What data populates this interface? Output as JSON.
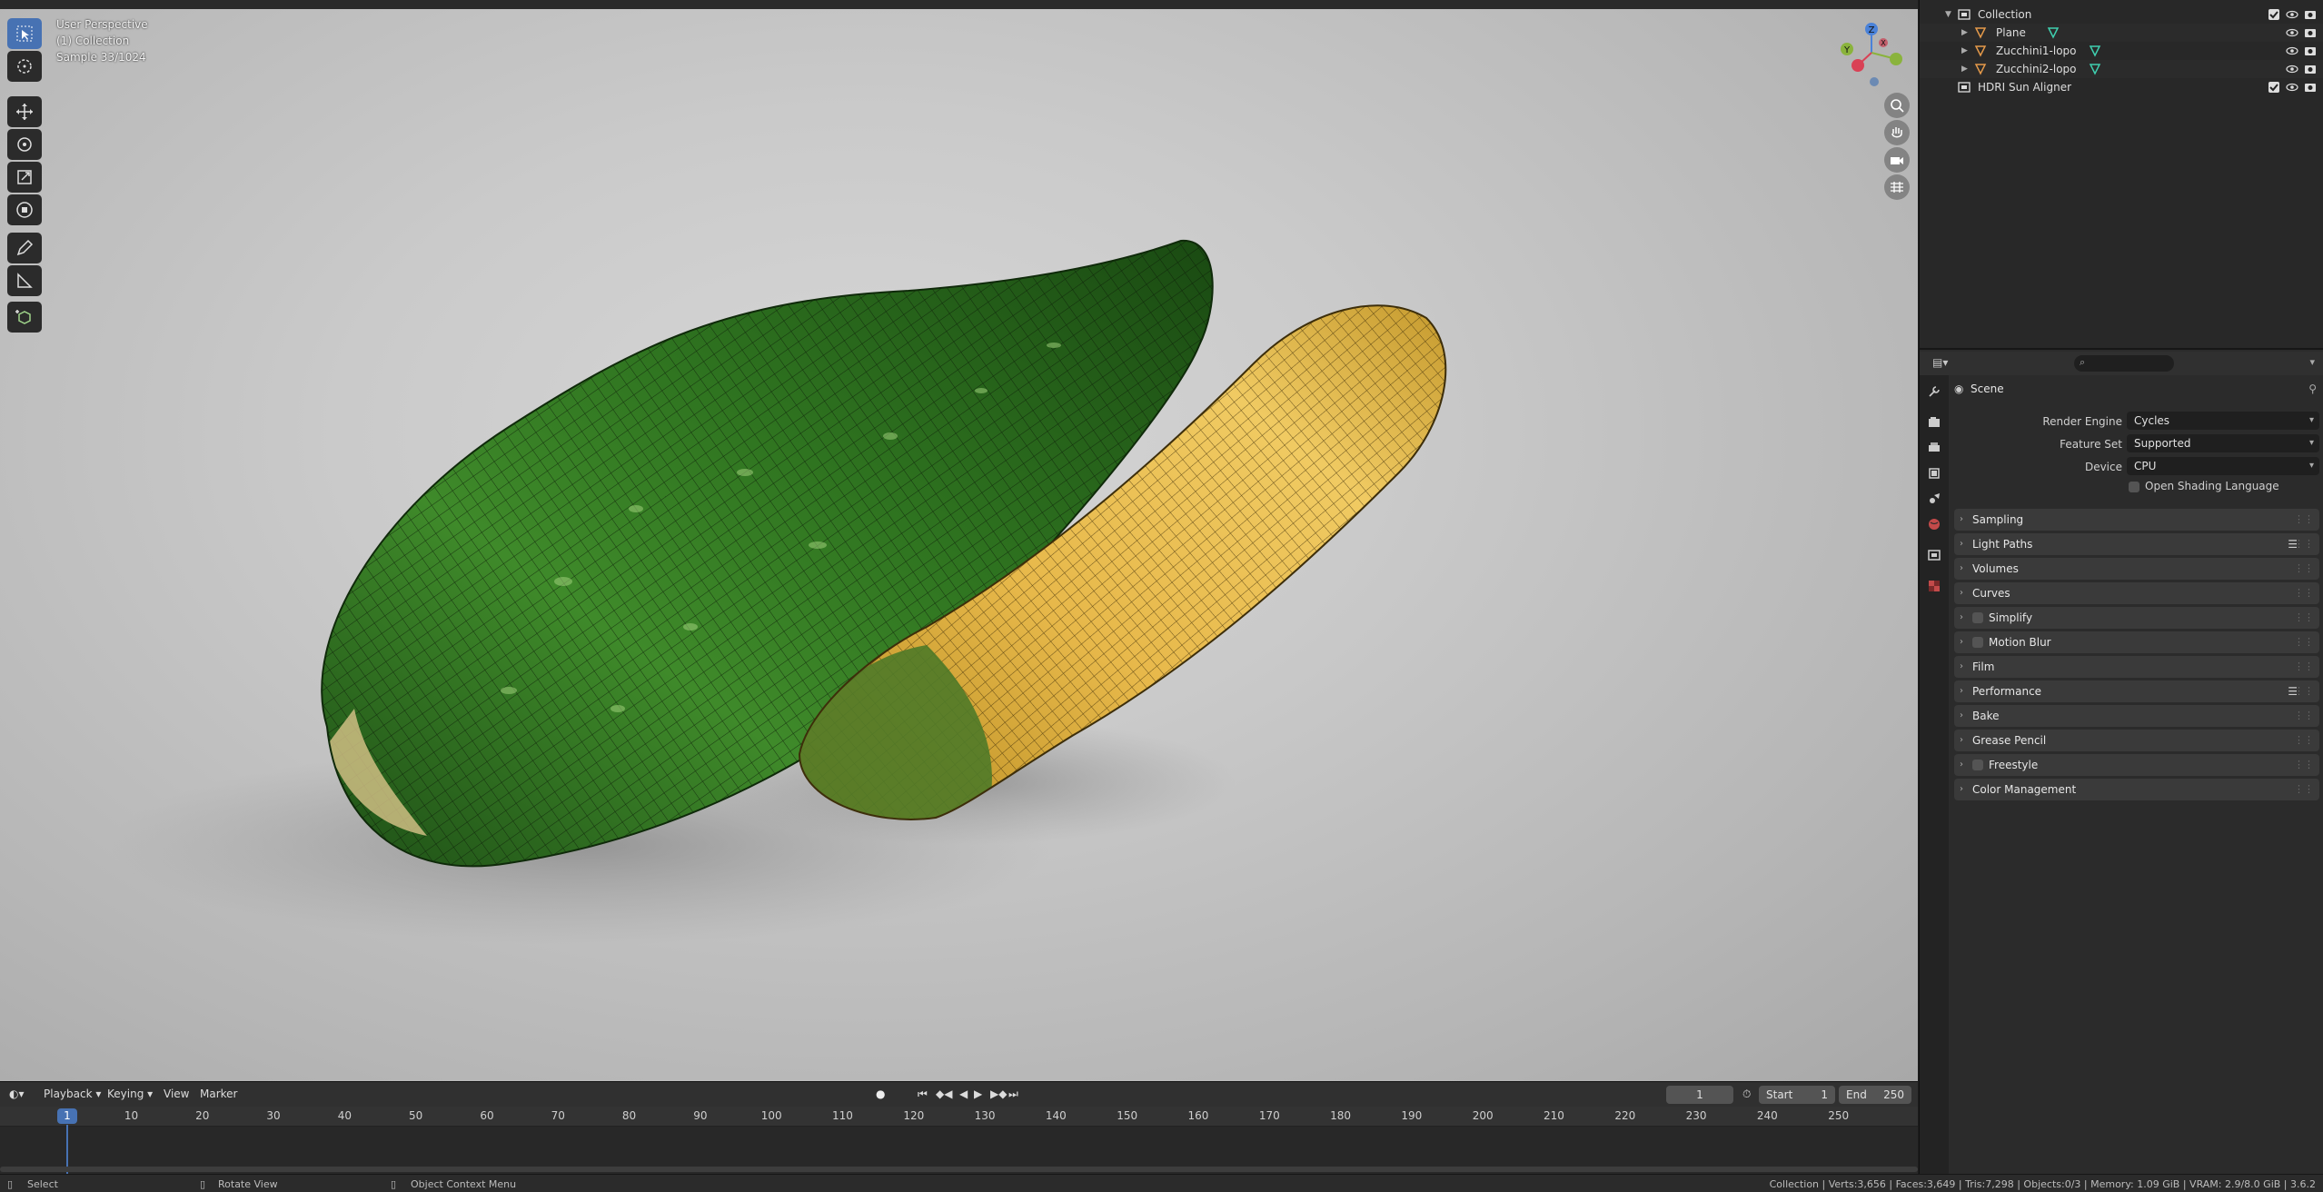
{
  "viewport": {
    "info": [
      "User Perspective",
      "(1) Collection",
      "Sample 33/1024"
    ],
    "gizmo": {
      "z": "Z",
      "y": "Y",
      "x": "X"
    },
    "colors": {
      "x": "#d94155",
      "y": "#8ab33c",
      "z": "#4a82d9"
    }
  },
  "timeline": {
    "menus": [
      "Playback",
      "Keying",
      "View",
      "Marker"
    ],
    "ticks": [
      "1",
      "10",
      "20",
      "30",
      "40",
      "50",
      "60",
      "70",
      "80",
      "90",
      "100",
      "110",
      "120",
      "130",
      "140",
      "150",
      "160",
      "170",
      "180",
      "190",
      "200",
      "210",
      "220",
      "230",
      "240",
      "250"
    ],
    "current_frame": "1",
    "start_label": "Start",
    "start_value": "1",
    "end_label": "End",
    "end_value": "250"
  },
  "status": {
    "select": "Select",
    "rotate": "Rotate View",
    "context": "Object Context Menu",
    "stats": "Collection | Verts:3,656 | Faces:3,649 | Tris:7,298 | Objects:0/3 | Memory: 1.09 GiB | VRAM: 2.9/8.0 GiB | 3.6.2"
  },
  "outliner": {
    "rows": [
      {
        "label": "Collection"
      },
      {
        "label": "Plane"
      },
      {
        "label": "Zucchini1-lopo"
      },
      {
        "label": "Zucchini2-lopo"
      },
      {
        "label": "HDRI Sun Aligner"
      }
    ]
  },
  "properties": {
    "crumb": "Scene",
    "render_engine_label": "Render Engine",
    "render_engine": "Cycles",
    "feature_set_label": "Feature Set",
    "feature_set": "Supported",
    "device_label": "Device",
    "device": "CPU",
    "osl_label": "Open Shading Language",
    "panels": [
      "Sampling",
      "Light Paths",
      "Volumes",
      "Curves",
      "Simplify",
      "Motion Blur",
      "Film",
      "Performance",
      "Bake",
      "Grease Pencil",
      "Freestyle",
      "Color Management"
    ]
  }
}
